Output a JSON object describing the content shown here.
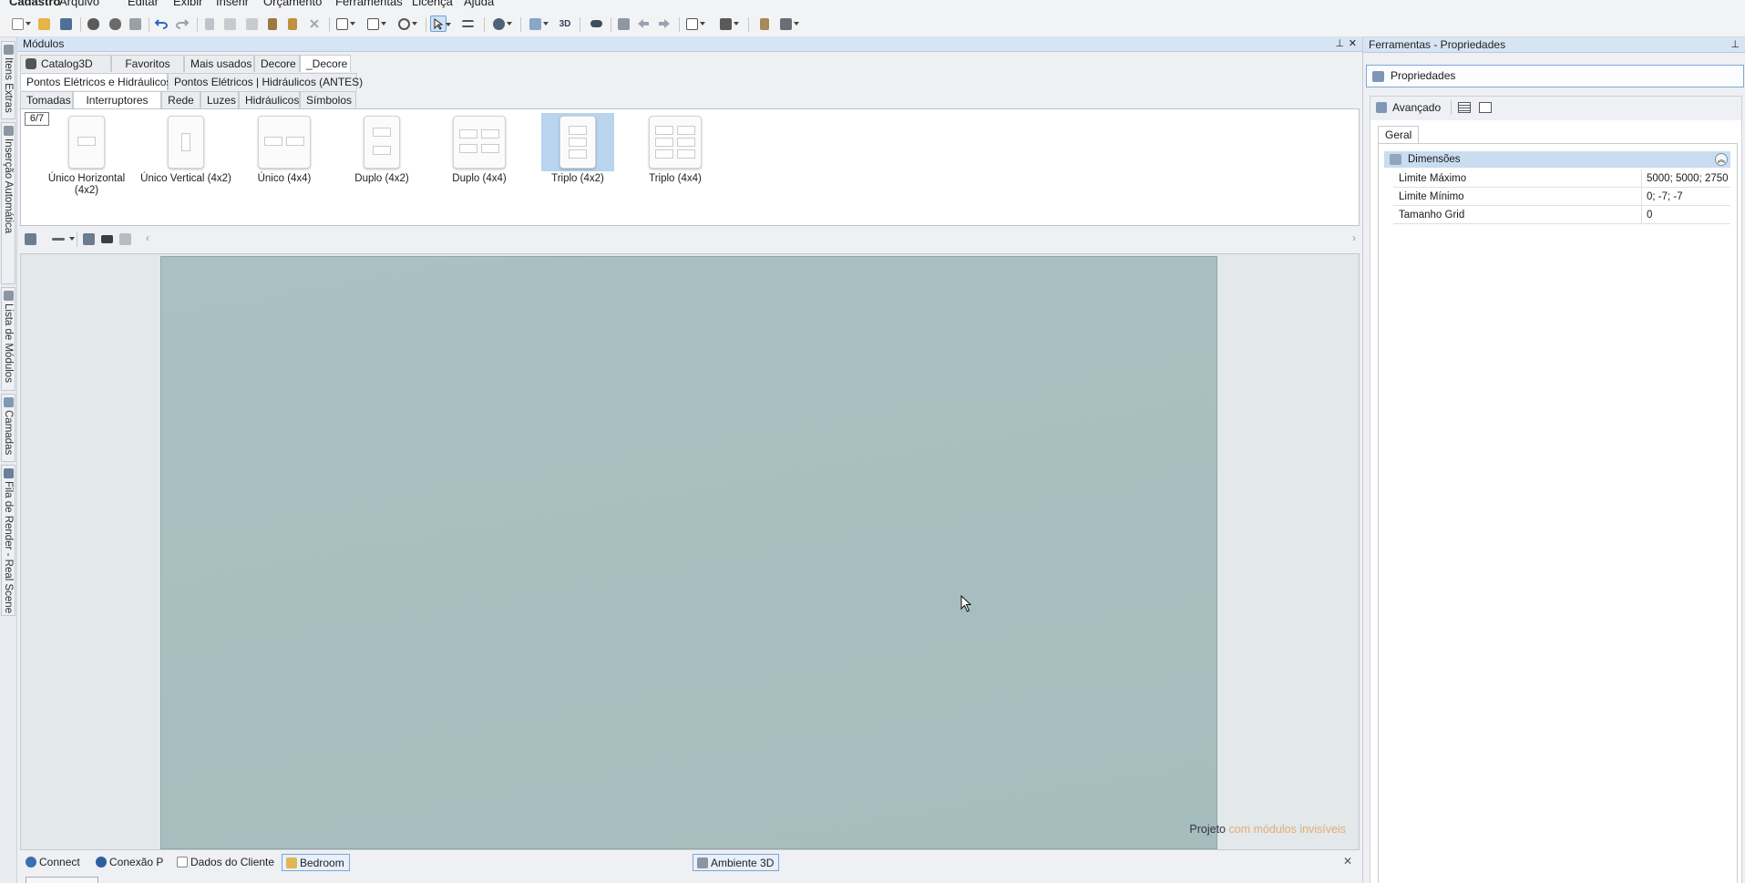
{
  "menu": [
    "Cadastro",
    "Arquivo",
    "Editar",
    "Exibir",
    "Inserir",
    "Orçamento",
    "Ferramentas",
    "Licença",
    "Ajuda"
  ],
  "toolbar_icons": [
    "new-file-icon",
    "open-folder-icon",
    "save-icon",
    "render-icon",
    "render-settings-icon",
    "print-icon",
    "undo-icon",
    "redo-icon",
    "cut-icon",
    "copy-icon",
    "paste-icon",
    "tool-icon",
    "format-painter-icon",
    "delete-icon",
    "view-mode-icon",
    "grid-icon",
    "lasso-icon",
    "select-arrow-icon",
    "measure-icon",
    "globe-icon",
    "layers-icon",
    "3d-icon",
    "eye-icon",
    "rotate-icon",
    "arrow-left-icon",
    "arrow-right-icon",
    "box-view-icon",
    "cube-icon",
    "lamp-icon",
    "camera-icon"
  ],
  "left_tabs": [
    "Itens Extras",
    "Inserção Automática",
    "Lista de Módulos",
    "Camadas",
    "Fila de Render - Real Scene"
  ],
  "modules_panel": {
    "title": "Módulos",
    "tabs_row1": [
      "Catalog3D",
      "Favoritos",
      "Mais usados",
      "Decore",
      "_Decore"
    ],
    "tabs_row2": [
      "Pontos Elétricos e Hidráulicos",
      "Pontos Elétricos | Hidráulicos (ANTES)"
    ],
    "tabs_row3": [
      "Tomadas",
      "Interruptores",
      "Rede",
      "Luzes",
      "Hidráulicos",
      "Símbolos"
    ],
    "counter": "6/7",
    "items": [
      {
        "label": "Único Horizontal (4x2)"
      },
      {
        "label": "Único Vertical (4x2)"
      },
      {
        "label": "Único (4x4)"
      },
      {
        "label": "Duplo (4x2)"
      },
      {
        "label": "Duplo (4x4)"
      },
      {
        "label": "Triplo (4x2)",
        "selected": true
      },
      {
        "label": "Triplo (4x4)"
      }
    ]
  },
  "viewport": {
    "note_a": "Projeto",
    "note_b": "com módulos invisíveis",
    "bg_color": "#a8bfc0"
  },
  "bottom_tabs": [
    "Connect",
    "Conexão P",
    "Dados do Cliente",
    "Bedroom"
  ],
  "bottom_center_tab": "Ambiente 3D",
  "properties_panel": {
    "title": "Ferramentas - Propriedades",
    "button": "Propriedades",
    "advanced": "Avançado",
    "tab": "Geral",
    "category": "Dimensões",
    "rows": [
      {
        "key": "Limite Máximo",
        "value": "5000; 5000; 2750"
      },
      {
        "key": "Limite Mínimo",
        "value": "0; -7; -7"
      },
      {
        "key": "Tamanho Grid",
        "value": "0"
      }
    ]
  },
  "colors": {
    "accent": "#6d9fd6",
    "header": "#d7e4f3",
    "selection": "#b9d4ee"
  }
}
